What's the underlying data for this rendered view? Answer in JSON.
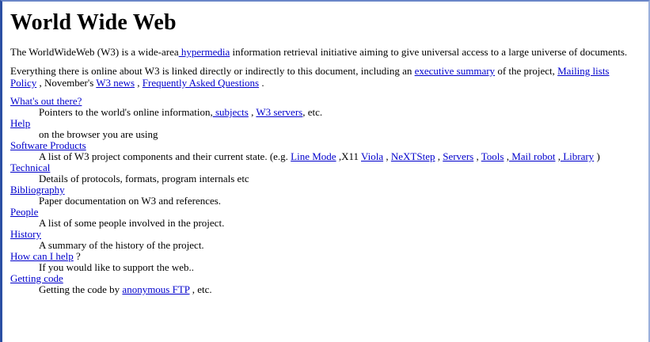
{
  "page": {
    "title": "World Wide Web",
    "intro": {
      "before": "The WorldWideWeb (W3) is a wide-area",
      "link": " hypermedia",
      "after": " information retrieval initiative aiming to give universal access to a large universe of documents."
    },
    "everything": {
      "before": "Everything there is online about W3 is linked directly or indirectly to this document, including an ",
      "link_summary": "executive summary",
      "mid1": " of the project, ",
      "link_mailing": "Mailing lists",
      "line2_link": "Policy",
      "mid2": " , November's ",
      "link_news": "W3 news",
      "mid3": " , ",
      "link_faq": "Frequently Asked Questions",
      "end": " ."
    }
  },
  "items": {
    "whats_out_there": {
      "term": "What's out there?",
      "desc_before": "Pointers to the world's online information,",
      "link_subjects": " subjects",
      "desc_mid": " , ",
      "link_servers": "W3 servers",
      "desc_after": ", etc."
    },
    "help": {
      "term": "Help",
      "desc": "on the browser you are using"
    },
    "software": {
      "term": "Software Products",
      "desc_before": "A list of W3 project components and their current state. (e.g. ",
      "link_line_mode": "Line Mode",
      "sep_x11": " ,X11 ",
      "link_viola": "Viola",
      "sep1": " , ",
      "link_nextstep": "NeXTStep",
      "sep2": " , ",
      "link_servers": "Servers",
      "sep3": " , ",
      "link_tools": "Tools",
      "sep4": " ,",
      "link_mail_robot": " Mail robot",
      "sep5": " ,",
      "link_library": " Library",
      "desc_after": " )"
    },
    "technical": {
      "term": "Technical",
      "desc": "Details of protocols, formats, program internals etc"
    },
    "bibliography": {
      "term": "Bibliography",
      "desc": "Paper documentation on W3 and references."
    },
    "people": {
      "term": "People",
      "desc": "A list of some people involved in the project."
    },
    "history": {
      "term": "History",
      "desc": "A summary of the history of the project."
    },
    "how_can_i_help": {
      "term": "How can I help",
      "term_after": " ?",
      "desc": "If you would like to support the web.."
    },
    "getting_code": {
      "term": "Getting code",
      "desc_before": "Getting the code by ",
      "link_ftp": "anonymous FTP",
      "desc_after": " , etc."
    }
  },
  "colors": {
    "link": "#0000cc",
    "text": "#000000",
    "background": "#ffffff",
    "frame_border": "#2b4fa3"
  }
}
